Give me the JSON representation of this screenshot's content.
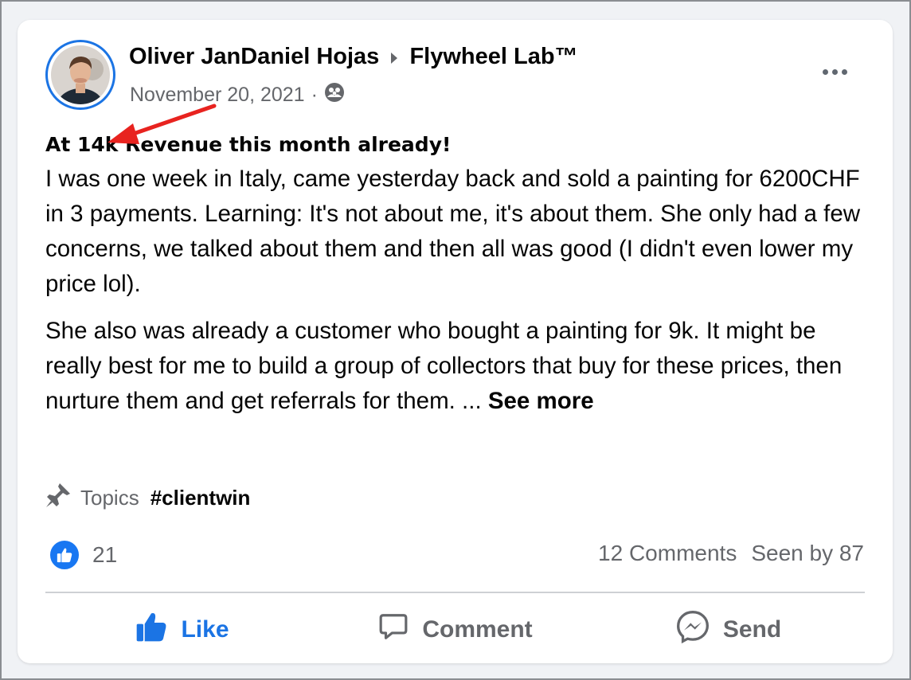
{
  "post": {
    "author": "Oliver JanDaniel Hojas",
    "group": "Flywheel Lab™",
    "date": "November 20, 2021",
    "separator": "·",
    "headline": "At 14k Revenue this month already!",
    "paragraph1": "I was one week in Italy, came yesterday back and sold a painting for 6200CHF in 3 payments. Learning: It's not about me, it's about them. She only had a few concerns, we talked about them and then all was good (I didn't even lower my price lol).",
    "paragraph2": "She also was already a customer who bought a painting for 9k. It might be really best for me to build a group of collectors that buy for these prices, then nurture them and get referrals for them. ...",
    "see_more": "See more"
  },
  "topics": {
    "label": "Topics",
    "tag": "#clientwin"
  },
  "engagement": {
    "likes": "21",
    "comments": "12 Comments",
    "seen_by": "Seen by 87"
  },
  "actions": {
    "like": "Like",
    "comment": "Comment",
    "send": "Send"
  },
  "colors": {
    "accent": "#1b74e4",
    "annotation_arrow": "#e8231f",
    "secondary_text": "#65676b"
  },
  "icons": [
    "avatar-photo",
    "caret-right-icon",
    "group-audience-icon",
    "more-dots-icon",
    "pin-icon",
    "like-reaction-icon",
    "thumbs-up-icon",
    "comment-icon",
    "messenger-icon"
  ]
}
